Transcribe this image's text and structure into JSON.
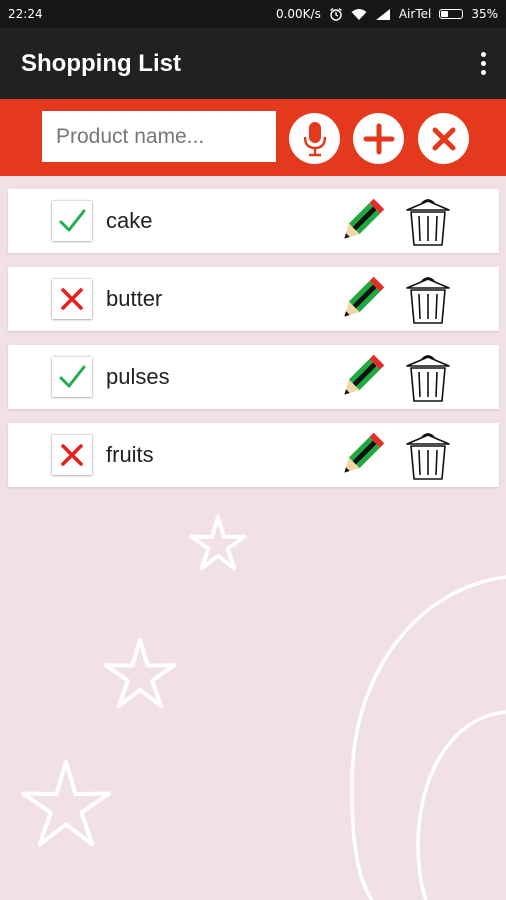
{
  "status_bar": {
    "time": "22:24",
    "speed": "0.00K/s",
    "carrier": "AirTel",
    "battery_text": "35%",
    "battery_level": 0.35
  },
  "app_bar": {
    "title": "Shopping List"
  },
  "input_bar": {
    "placeholder": "Product name...",
    "value": ""
  },
  "items": [
    {
      "name": "cake",
      "status": "checked"
    },
    {
      "name": "butter",
      "status": "crossed"
    },
    {
      "name": "pulses",
      "status": "checked"
    },
    {
      "name": "fruits",
      "status": "crossed"
    }
  ],
  "colors": {
    "accent": "#e5391d",
    "app_bar": "#212121",
    "status_bar": "#161616",
    "background": "#f2e1e4",
    "check_green": "#22b04b",
    "cross_red": "#e2231a"
  },
  "icons": {
    "mic": "microphone-icon",
    "add": "plus-icon",
    "clear": "close-icon",
    "edit": "pencil-icon",
    "delete": "trash-icon",
    "menu": "overflow-menu-icon"
  }
}
